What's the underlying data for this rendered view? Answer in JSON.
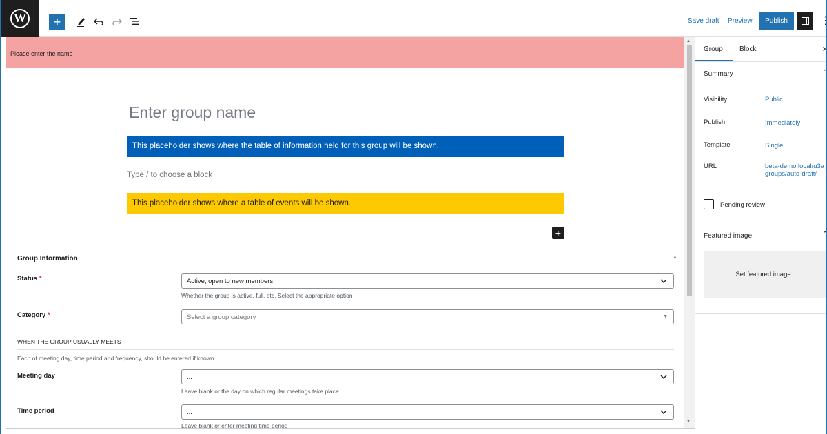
{
  "toolbar": {
    "logo_letter": "W",
    "add_icon": "+",
    "edit_icon": "pen-icon",
    "undo_icon": "undo-icon",
    "redo_icon": "redo-icon",
    "list_icon": "list-view-icon",
    "save_draft": "Save draft",
    "preview": "Preview",
    "publish": "Publish"
  },
  "notice": {
    "text": "Please enter the name"
  },
  "editor": {
    "title_placeholder": "Enter group name",
    "info_placeholder": "This placeholder shows where the table of information held for this group will be shown.",
    "block_prompt": "Type / to choose a block",
    "events_placeholder": "This placeholder shows where a table of events will be shown.",
    "add_block": "+"
  },
  "metabox": {
    "title": "Group Information",
    "status": {
      "label": "Status",
      "required": "*",
      "value": "Active, open to new members",
      "help": "Whether the group is active, full, etc. Select the appropriate option"
    },
    "category": {
      "label": "Category",
      "required": "*",
      "placeholder": "Select a group category"
    },
    "meets_heading": "WHEN THE GROUP USUALLY MEETS",
    "meets_desc": "Each of meeting day, time period and frequency, should be entered if known",
    "meeting_day": {
      "label": "Meeting day",
      "value": "...",
      "help": "Leave blank or the day on which regular meetings take place"
    },
    "time_period": {
      "label": "Time period",
      "value": "...",
      "help": "Leave blank or enter meeting time period"
    }
  },
  "sidebar": {
    "tabs": [
      "Group",
      "Block"
    ],
    "close": "×",
    "summary": {
      "title": "Summary",
      "rows": [
        {
          "label": "Visibility",
          "value": "Public"
        },
        {
          "label": "Publish",
          "value": "Immediately"
        },
        {
          "label": "Template",
          "value": "Single"
        },
        {
          "label": "URL",
          "value": "beta-demo.local/u3a_groups/auto-draft/"
        }
      ],
      "pending_review": "Pending review"
    },
    "featured": {
      "title": "Featured image",
      "button": "Set featured image"
    }
  },
  "colors": {
    "accent": "#2271b1",
    "notice_bg": "#f4a2a2",
    "info_placeholder_bg": "#005fb8",
    "events_placeholder_bg": "#ffc900"
  }
}
